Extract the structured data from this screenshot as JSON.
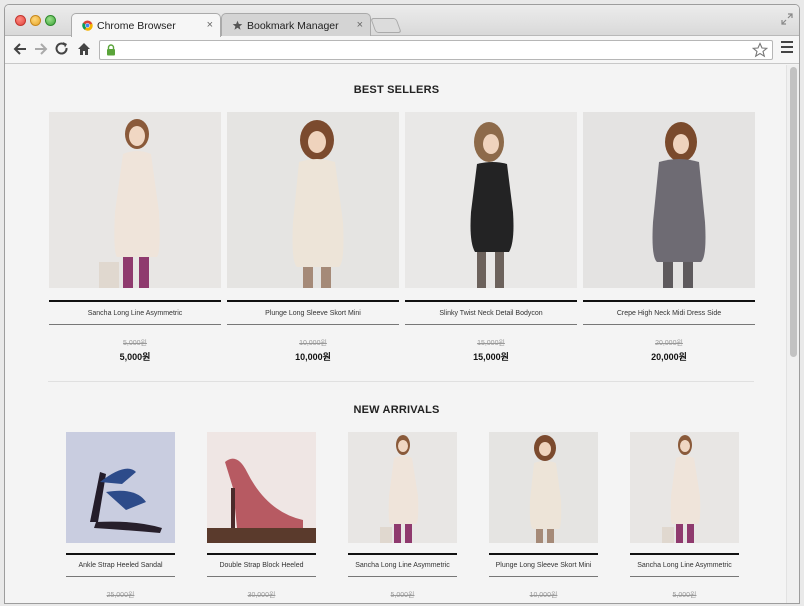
{
  "browser": {
    "tabs": [
      {
        "label": "Chrome Browser",
        "active": true
      },
      {
        "label": "Bookmark Manager",
        "active": false
      }
    ],
    "address": "",
    "tab_close_glyph": "×"
  },
  "best_sellers": {
    "title": "BEST SELLERS",
    "products": [
      {
        "name": "Sancha Long Line Asymmetric",
        "old_price": "5,000원",
        "price": "5,000원",
        "image": "cream-dress-model"
      },
      {
        "name": "Plunge Long Sleeve Skort Mini",
        "old_price": "10,000원",
        "price": "10,000원",
        "image": "cream-dress-curly-model"
      },
      {
        "name": "Slinky Twist Neck Detail Bodycon",
        "old_price": "15,000원",
        "price": "15,000원",
        "image": "black-dress-model"
      },
      {
        "name": "Crepe High Neck Midi Dress Side",
        "old_price": "20,000원",
        "price": "20,000원",
        "image": "grey-dress-model"
      }
    ]
  },
  "new_arrivals": {
    "title": "NEW ARRIVALS",
    "products": [
      {
        "name": "Ankle Strap Heeled Sandal",
        "old_price": "25,000원",
        "image": "blue-strap-sandal"
      },
      {
        "name": "Double Strap Block Heeled",
        "old_price": "30,000원",
        "image": "red-stiletto"
      },
      {
        "name": "Sancha Long Line Asymmetric",
        "old_price": "5,000원",
        "image": "cream-dress-model"
      },
      {
        "name": "Plunge Long Sleeve Skort Mini",
        "old_price": "10,000원",
        "image": "cream-dress-curly-model"
      },
      {
        "name": "Sancha Long Line Asymmetric",
        "old_price": "5,000원",
        "image": "cream-dress-model"
      }
    ]
  },
  "colors": {
    "accent_line": "#111111",
    "background": "#f4f4f4",
    "image_bg": "#e7e7e7"
  }
}
